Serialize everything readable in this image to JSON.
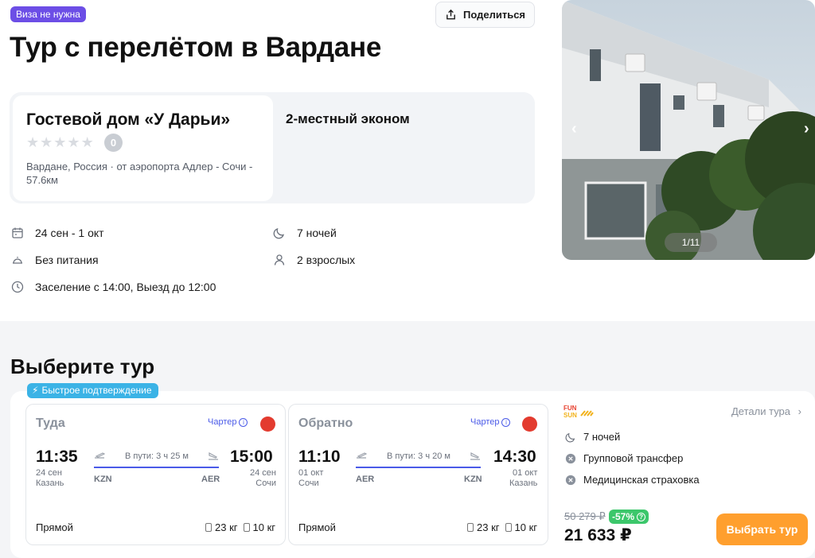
{
  "header": {
    "visa_badge": "Виза не нужна",
    "share_label": "Поделиться",
    "title": "Тур с перелётом в Вардане"
  },
  "hotel": {
    "name": "Гостевой дом «У Дарьи»",
    "stars": 5,
    "rating": "0",
    "location": "Вардане, Россия · от аэропорта Адлер - Сочи - 57.6км",
    "room_type": "2-местный эконом"
  },
  "trip_info": {
    "dates": "24 сен - 1 окт",
    "nights": "7 ночей",
    "meals": "Без питания",
    "guests": "2 взрослых",
    "checkin": "Заселение с 14:00, Выезд до 12:00",
    "icons": [
      "calendar-icon",
      "moon-icon",
      "cloche-icon",
      "person-icon",
      "clock-icon"
    ]
  },
  "photo": {
    "counter": "1/11"
  },
  "tours": {
    "section_title": "Выберите тур",
    "fast_badge": "Быстрое подтверждение",
    "outbound": {
      "direction": "Туда",
      "charter": "Чартер",
      "dep_time": "11:35",
      "dep_date": "24 сен",
      "dep_city": "Казань",
      "arr_time": "15:00",
      "arr_date": "24 сен",
      "arr_city": "Сочи",
      "duration": "В пути: 3 ч 25 м",
      "from_code": "KZN",
      "to_code": "AER",
      "type": "Прямой",
      "baggage": "23 кг",
      "hand": "10 кг"
    },
    "return": {
      "direction": "Обратно",
      "charter": "Чартер",
      "dep_time": "11:10",
      "dep_date": "01 окт",
      "dep_city": "Сочи",
      "arr_time": "14:30",
      "arr_date": "01 окт",
      "arr_city": "Казань",
      "duration": "В пути: 3 ч 20 м",
      "from_code": "AER",
      "to_code": "KZN",
      "type": "Прямой",
      "baggage": "23 кг",
      "hand": "10 кг"
    },
    "side": {
      "details_link": "Детали тура",
      "nights": "7 ночей",
      "transfer": "Групповой трансфер",
      "insurance": "Медицинская страховка",
      "old_price": "50 279 ₽",
      "discount": "-57%",
      "price": "21 633 ₽",
      "choose_label": "Выбрать тур"
    }
  },
  "colors": {
    "visa_badge": "#6c4ee6",
    "fast_badge": "#3bb3e6",
    "accent_blue": "#4a5ae8",
    "cta_orange": "#ff9f2e",
    "discount_green": "#3cc76b",
    "airline_red": "#e33b2f"
  }
}
